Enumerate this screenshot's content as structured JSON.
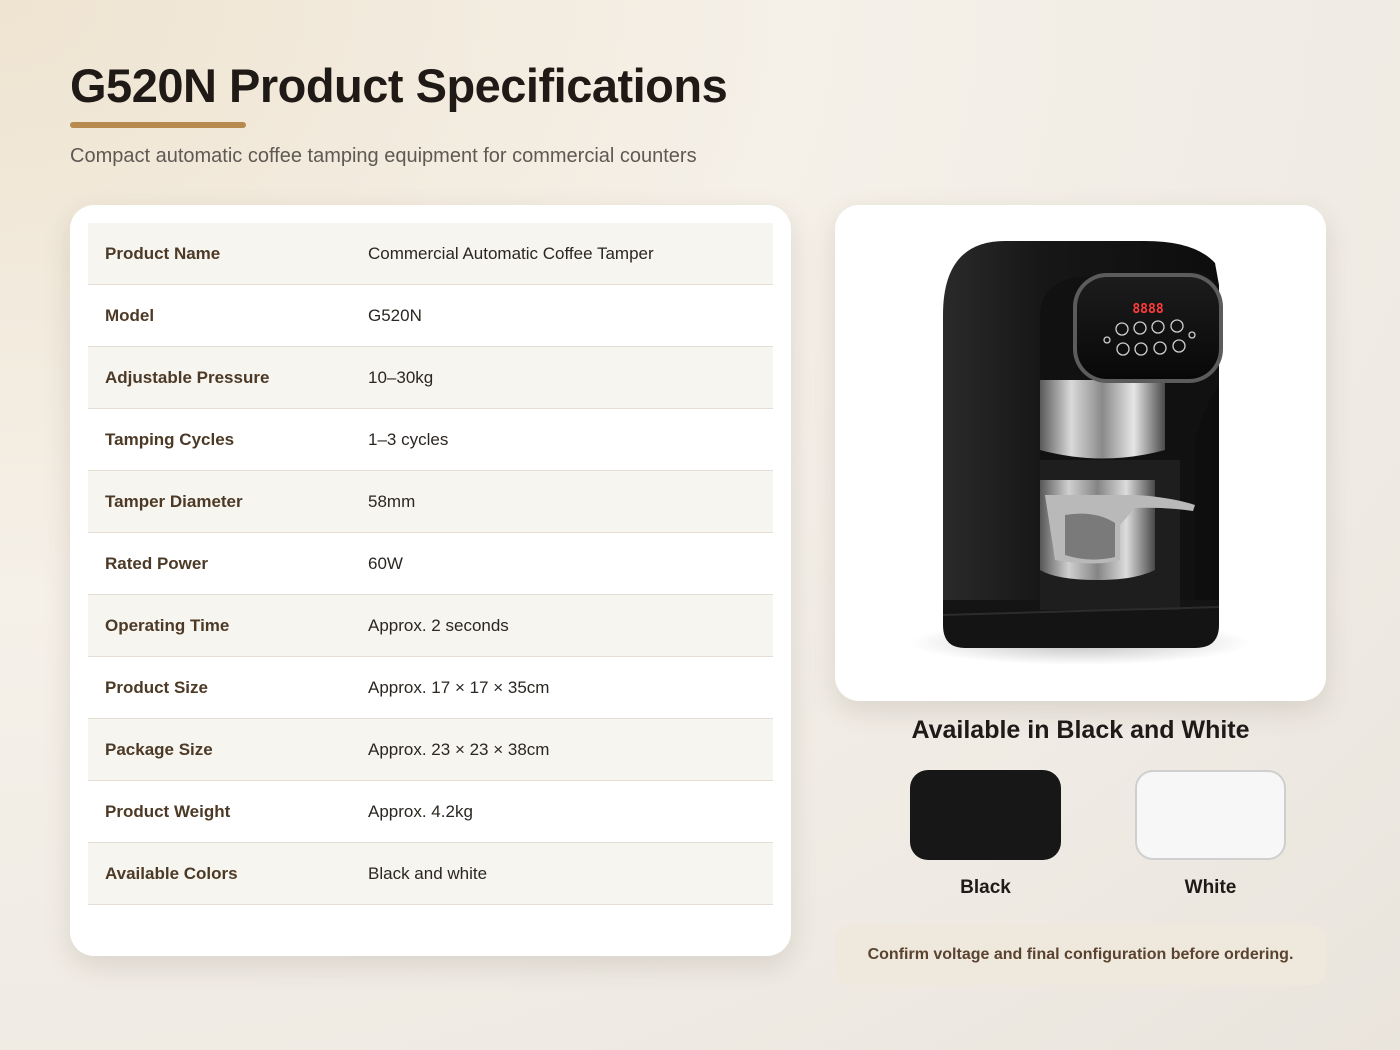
{
  "header": {
    "title": "G520N Product Specifications",
    "subtitle": "Compact automatic coffee tamping equipment for commercial counters"
  },
  "specs": [
    {
      "label": "Product Name",
      "value": "Commercial Automatic Coffee Tamper"
    },
    {
      "label": "Model",
      "value": "G520N"
    },
    {
      "label": "Adjustable Pressure",
      "value": "10–30kg"
    },
    {
      "label": "Tamping Cycles",
      "value": "1–3 cycles"
    },
    {
      "label": "Tamper Diameter",
      "value": "58mm"
    },
    {
      "label": "Rated Power",
      "value": "60W"
    },
    {
      "label": "Operating Time",
      "value": "Approx. 2 seconds"
    },
    {
      "label": "Product Size",
      "value": "Approx. 17 × 17 × 35cm"
    },
    {
      "label": "Package Size",
      "value": "Approx. 23 × 23 × 38cm"
    },
    {
      "label": "Product Weight",
      "value": "Approx. 4.2kg"
    },
    {
      "label": "Available Colors",
      "value": "Black and white"
    }
  ],
  "product_image": {
    "display_text": "8888"
  },
  "colors": {
    "title": "Available in Black and White",
    "options": [
      {
        "label": "Black",
        "hex": "#171717"
      },
      {
        "label": "White",
        "hex": "#f7f7f7"
      }
    ]
  },
  "note": "Confirm voltage and final configuration before ordering.",
  "theme": {
    "accent": "#b78a4d"
  }
}
